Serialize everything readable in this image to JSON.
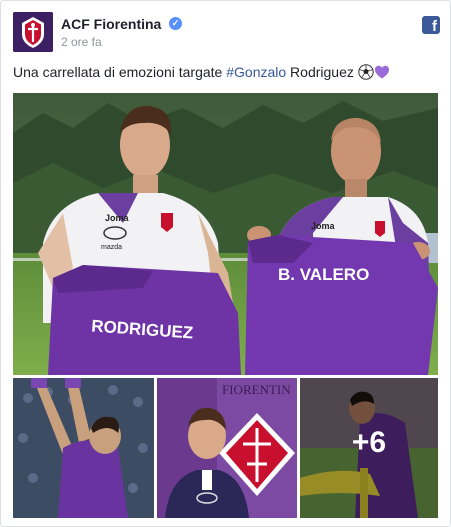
{
  "post": {
    "page_name": "ACF Fiorentina",
    "timestamp": "2 ore fa",
    "text_before": "Una carrellata di emozioni targate ",
    "hashtag": "#Gonzalo",
    "text_after": " Rodriguez ",
    "emojis": [
      "soccer-ball",
      "purple-heart"
    ]
  },
  "photos": {
    "main": {
      "shirt_left": "RODRIGUEZ",
      "shirt_right": "B. VALERO",
      "sponsor_left": "Joma",
      "sponsor_right": "Joma",
      "sponsor2": "mazda"
    },
    "thumb2_sign": "FIORENTIN",
    "more_count": "+6"
  },
  "colors": {
    "accent": "#365899",
    "brand_purple": "#5b2c8d",
    "verified": "#5890ff",
    "facebook": "#3b5998"
  }
}
